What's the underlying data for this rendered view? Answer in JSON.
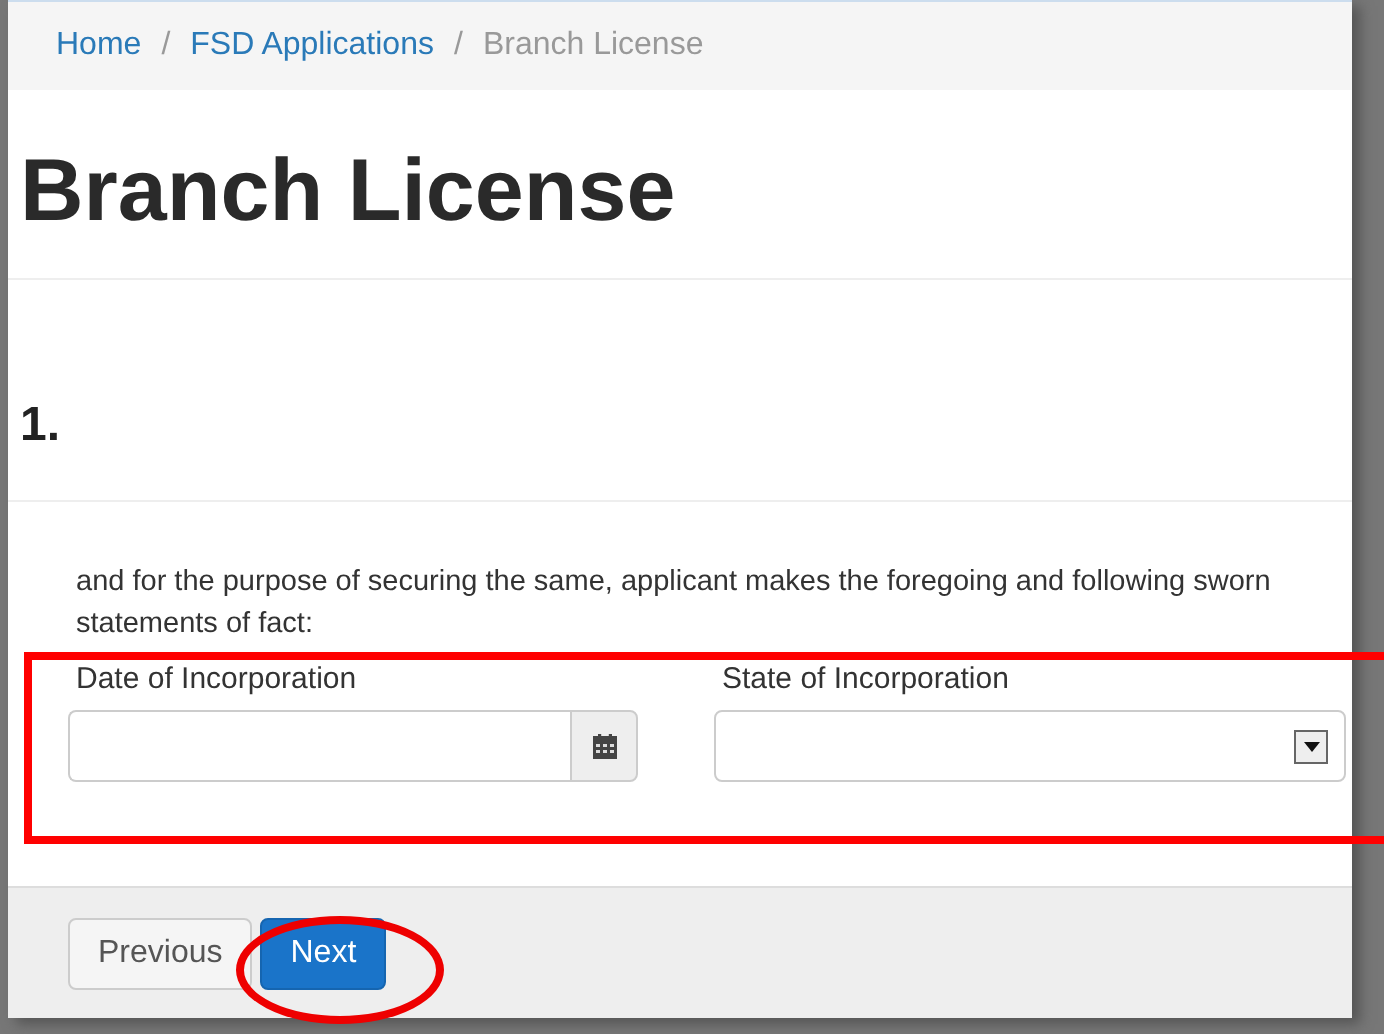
{
  "breadcrumb": [
    {
      "label": "Home",
      "active": false
    },
    {
      "separator": "/",
      "label": "FSD Applications",
      "active": false
    },
    {
      "separator": "/",
      "label": "Branch License",
      "active": true
    }
  ],
  "title": "Branch License",
  "section": {
    "number": "1."
  },
  "statement": "and for the purpose of securing the same, applicant makes the foregoing and following sworn statements of fact:",
  "fields": [
    {
      "label": "Date of Incorporation",
      "kind": "date"
    },
    {
      "label": "State of Incorporation",
      "kind": "select"
    }
  ],
  "buttons": [
    {
      "label": "Previous",
      "kind": "default"
    },
    {
      "label": "Next",
      "kind": "primary"
    }
  ]
}
